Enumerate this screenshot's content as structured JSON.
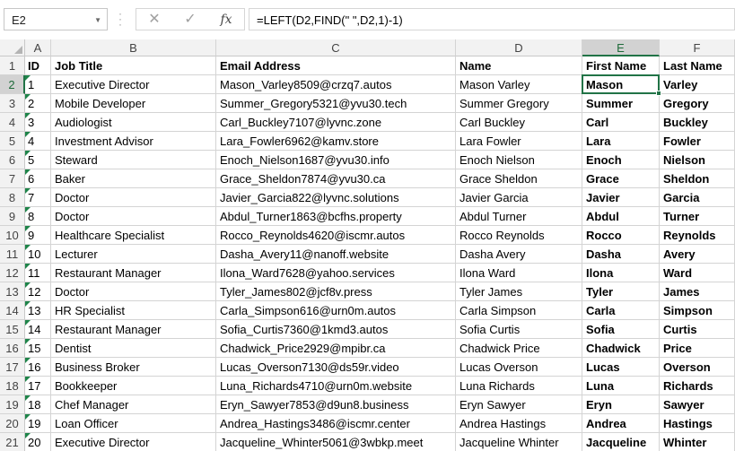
{
  "formula_bar": {
    "name_box": "E2",
    "cancel_icon": "cancel-icon",
    "enter_icon": "check-icon",
    "fx_label": "fx",
    "formula": "=LEFT(D2,FIND(\" \",D2,1)-1)"
  },
  "columns": [
    "A",
    "B",
    "C",
    "D",
    "E",
    "F"
  ],
  "selected_column": "E",
  "selected_row": "2",
  "rows": [
    {
      "n": "1",
      "cells": [
        "ID",
        "Job Title",
        "Email Address",
        "Name",
        "First Name",
        "Last Name"
      ]
    },
    {
      "n": "2",
      "cells": [
        "1",
        "Executive Director",
        "Mason_Varley8509@crzq7.autos",
        "Mason Varley",
        "Mason",
        "Varley"
      ]
    },
    {
      "n": "3",
      "cells": [
        "2",
        "Mobile Developer",
        "Summer_Gregory5321@yvu30.tech",
        "Summer Gregory",
        "Summer",
        "Gregory"
      ]
    },
    {
      "n": "4",
      "cells": [
        "3",
        "Audiologist",
        "Carl_Buckley7107@lyvnc.zone",
        "Carl Buckley",
        "Carl",
        "Buckley"
      ]
    },
    {
      "n": "5",
      "cells": [
        "4",
        "Investment Advisor",
        "Lara_Fowler6962@kamv.store",
        "Lara Fowler",
        "Lara",
        "Fowler"
      ]
    },
    {
      "n": "6",
      "cells": [
        "5",
        "Steward",
        "Enoch_Nielson1687@yvu30.info",
        "Enoch Nielson",
        "Enoch",
        "Nielson"
      ]
    },
    {
      "n": "7",
      "cells": [
        "6",
        "Baker",
        "Grace_Sheldon7874@yvu30.ca",
        "Grace Sheldon",
        "Grace",
        "Sheldon"
      ]
    },
    {
      "n": "8",
      "cells": [
        "7",
        "Doctor",
        "Javier_Garcia822@lyvnc.solutions",
        "Javier Garcia",
        "Javier",
        "Garcia"
      ]
    },
    {
      "n": "9",
      "cells": [
        "8",
        "Doctor",
        "Abdul_Turner1863@bcfhs.property",
        "Abdul Turner",
        "Abdul",
        "Turner"
      ]
    },
    {
      "n": "10",
      "cells": [
        "9",
        "Healthcare Specialist",
        "Rocco_Reynolds4620@iscmr.autos",
        "Rocco Reynolds",
        "Rocco",
        "Reynolds"
      ]
    },
    {
      "n": "11",
      "cells": [
        "10",
        "Lecturer",
        "Dasha_Avery11@nanoff.website",
        "Dasha Avery",
        "Dasha",
        "Avery"
      ]
    },
    {
      "n": "12",
      "cells": [
        "11",
        "Restaurant Manager",
        "Ilona_Ward7628@yahoo.services",
        "Ilona Ward",
        "Ilona",
        "Ward"
      ]
    },
    {
      "n": "13",
      "cells": [
        "12",
        "Doctor",
        "Tyler_James802@jcf8v.press",
        "Tyler James",
        "Tyler",
        "James"
      ]
    },
    {
      "n": "14",
      "cells": [
        "13",
        "HR Specialist",
        "Carla_Simpson616@urn0m.autos",
        "Carla Simpson",
        "Carla",
        "Simpson"
      ]
    },
    {
      "n": "15",
      "cells": [
        "14",
        "Restaurant Manager",
        "Sofia_Curtis7360@1kmd3.autos",
        "Sofia Curtis",
        "Sofia",
        "Curtis"
      ]
    },
    {
      "n": "16",
      "cells": [
        "15",
        "Dentist",
        "Chadwick_Price2929@mpibr.ca",
        "Chadwick Price",
        "Chadwick",
        "Price"
      ]
    },
    {
      "n": "17",
      "cells": [
        "16",
        "Business Broker",
        "Lucas_Overson7130@ds59r.video",
        "Lucas Overson",
        "Lucas",
        "Overson"
      ]
    },
    {
      "n": "18",
      "cells": [
        "17",
        "Bookkeeper",
        "Luna_Richards4710@urn0m.website",
        "Luna Richards",
        "Luna",
        "Richards"
      ]
    },
    {
      "n": "19",
      "cells": [
        "18",
        "Chef Manager",
        "Eryn_Sawyer7853@d9un8.business",
        "Eryn Sawyer",
        "Eryn",
        "Sawyer"
      ]
    },
    {
      "n": "20",
      "cells": [
        "19",
        "Loan Officer",
        "Andrea_Hastings3486@iscmr.center",
        "Andrea Hastings",
        "Andrea",
        "Hastings"
      ]
    },
    {
      "n": "21",
      "cells": [
        "20",
        "Executive Director",
        "Jacqueline_Whinter5061@3wbkp.meet",
        "Jacqueline Whinter",
        "Jacqueline",
        "Whinter"
      ]
    }
  ]
}
